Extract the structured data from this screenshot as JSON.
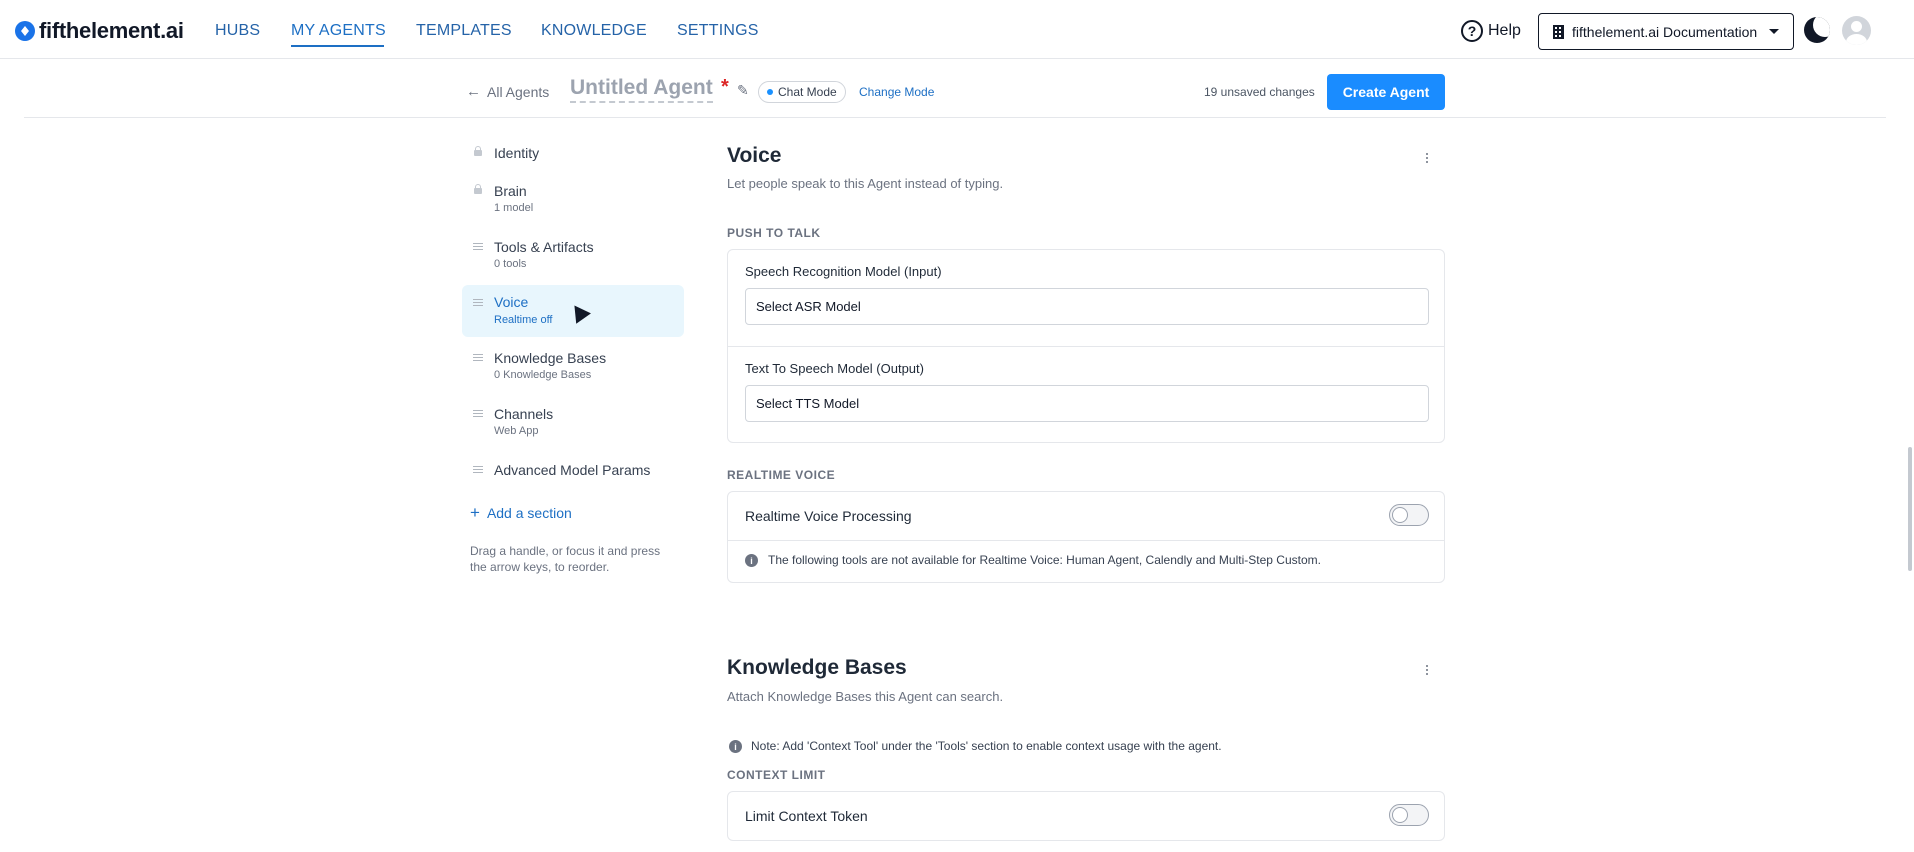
{
  "nav": {
    "logo": "fifthelement.ai",
    "tabs": [
      "HUBS",
      "MY AGENTS",
      "TEMPLATES",
      "KNOWLEDGE",
      "SETTINGS"
    ],
    "active_tab": "MY AGENTS",
    "help": "Help",
    "docs_button": "fifthelement.ai Documentation",
    "accent": "#1d6fc4"
  },
  "agent_bar": {
    "back": "All Agents",
    "agent_name": "Untitled Agent",
    "required_marker": "*",
    "mode": "Chat Mode",
    "change_mode": "Change Mode",
    "unsaved": "19 unsaved changes",
    "create": "Create Agent",
    "create_color": "#1a8cff"
  },
  "sidebar": {
    "items": [
      {
        "label": "Identity",
        "sub": "",
        "icon": "lock-icon"
      },
      {
        "label": "Brain",
        "sub": "1 model",
        "icon": "lock-icon"
      },
      {
        "label": "Tools & Artifacts",
        "sub": "0 tools",
        "icon": "drag-handle-icon"
      },
      {
        "label": "Voice",
        "sub": "Realtime off",
        "icon": "drag-handle-icon",
        "active": true
      },
      {
        "label": "Knowledge Bases",
        "sub": "0 Knowledge Bases",
        "icon": "drag-handle-icon"
      },
      {
        "label": "Channels",
        "sub": "Web App",
        "icon": "drag-handle-icon"
      },
      {
        "label": "Advanced Model Params",
        "sub": "",
        "icon": "drag-handle-icon"
      }
    ],
    "add_section": "Add a section",
    "drag_hint": "Drag a handle, or focus it and press the arrow keys, to reorder."
  },
  "voice": {
    "title": "Voice",
    "description": "Let people speak to this Agent instead of typing.",
    "push_to_talk": {
      "label": "PUSH TO TALK",
      "asr_label": "Speech Recognition Model (Input)",
      "asr_value": "Select ASR Model",
      "tts_label": "Text To Speech Model (Output)",
      "tts_value": "Select TTS Model"
    },
    "realtime": {
      "label": "REALTIME VOICE",
      "toggle_label": "Realtime Voice Processing",
      "toggle_on": false,
      "note": "The following tools are not available for Realtime Voice: Human Agent, Calendly and Multi-Step Custom."
    }
  },
  "knowledge": {
    "title": "Knowledge Bases",
    "description": "Attach Knowledge Bases this Agent can search.",
    "note": "Note: Add 'Context Tool' under the 'Tools' section to enable context usage with the agent.",
    "context_limit": {
      "label": "CONTEXT LIMIT",
      "toggle_label": "Limit Context Token",
      "toggle_on": false
    }
  }
}
